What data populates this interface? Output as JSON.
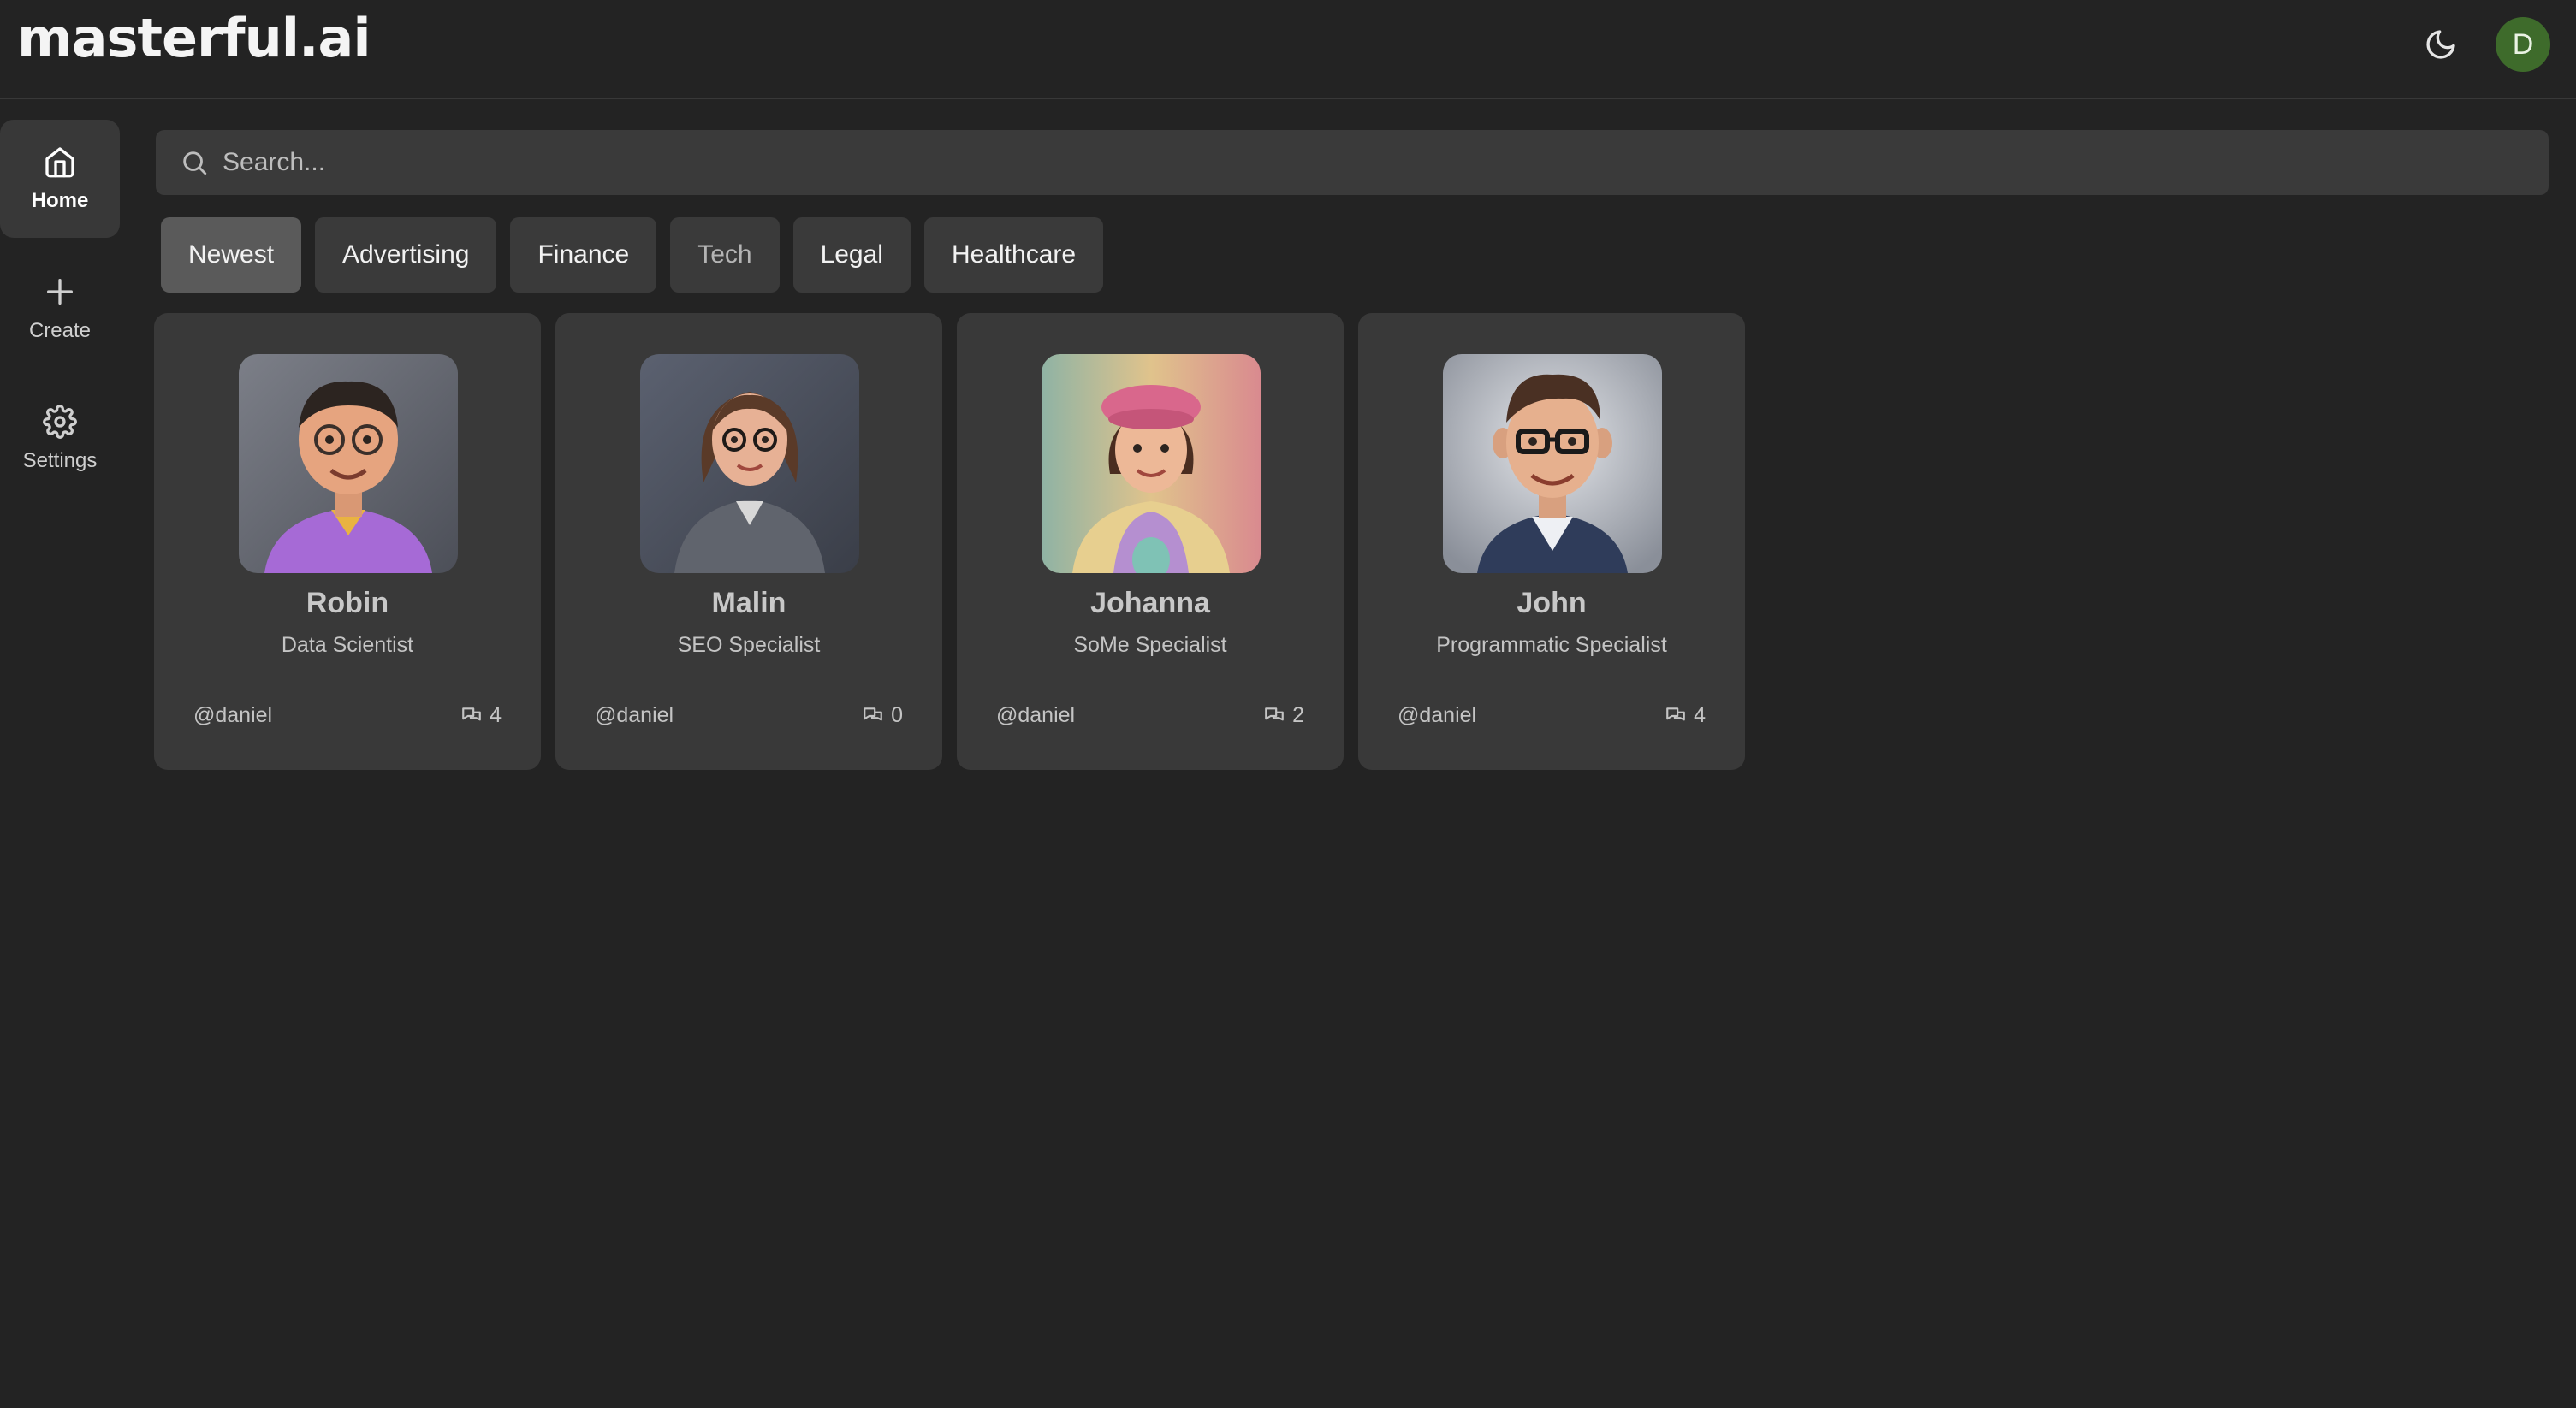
{
  "header": {
    "logo": "masterful.ai",
    "avatar_initial": "D"
  },
  "sidebar": {
    "items": [
      {
        "label": "Home",
        "icon": "home-icon",
        "active": true
      },
      {
        "label": "Create",
        "icon": "plus-icon"
      },
      {
        "label": "Settings",
        "icon": "gear-icon"
      }
    ]
  },
  "search": {
    "placeholder": "Search..."
  },
  "filters": [
    "Newest",
    "Advertising",
    "Finance",
    "Tech",
    "Legal",
    "Healthcare"
  ],
  "cards": [
    {
      "name": "Robin",
      "role": "Data Scientist",
      "user": "@daniel",
      "count": "4"
    },
    {
      "name": "Malin",
      "role": "SEO Specialist",
      "user": "@daniel",
      "count": "0"
    },
    {
      "name": "Johanna",
      "role": "SoMe Specialist",
      "user": "@daniel",
      "count": "2"
    },
    {
      "name": "John",
      "role": "Programmatic Specialist",
      "user": "@daniel",
      "count": "4"
    }
  ],
  "colors": {
    "background": "#232323",
    "card": "#393939",
    "avatar": "#3e6b2b"
  }
}
